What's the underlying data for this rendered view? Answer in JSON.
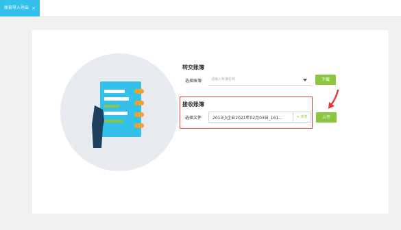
{
  "tab": {
    "label": "账套导入导出",
    "close": "×"
  },
  "transfer": {
    "title": "转交账簿",
    "field_label": "选择账簿",
    "placeholder": "请输入账簿名称",
    "download_label": "下载"
  },
  "receive": {
    "title": "接收账簿",
    "field_label": "选择文件",
    "file_value": "2013小企业2021年02月03日_161...",
    "browse_label": "+ 浏览",
    "upload_label": "上传"
  },
  "colors": {
    "accent": "#33c0ea",
    "green": "#8cc63f",
    "highlight": "#e53935"
  },
  "icons": [
    "notebook-icon",
    "hand-icon",
    "chevron-down-icon",
    "arrow-icon"
  ]
}
